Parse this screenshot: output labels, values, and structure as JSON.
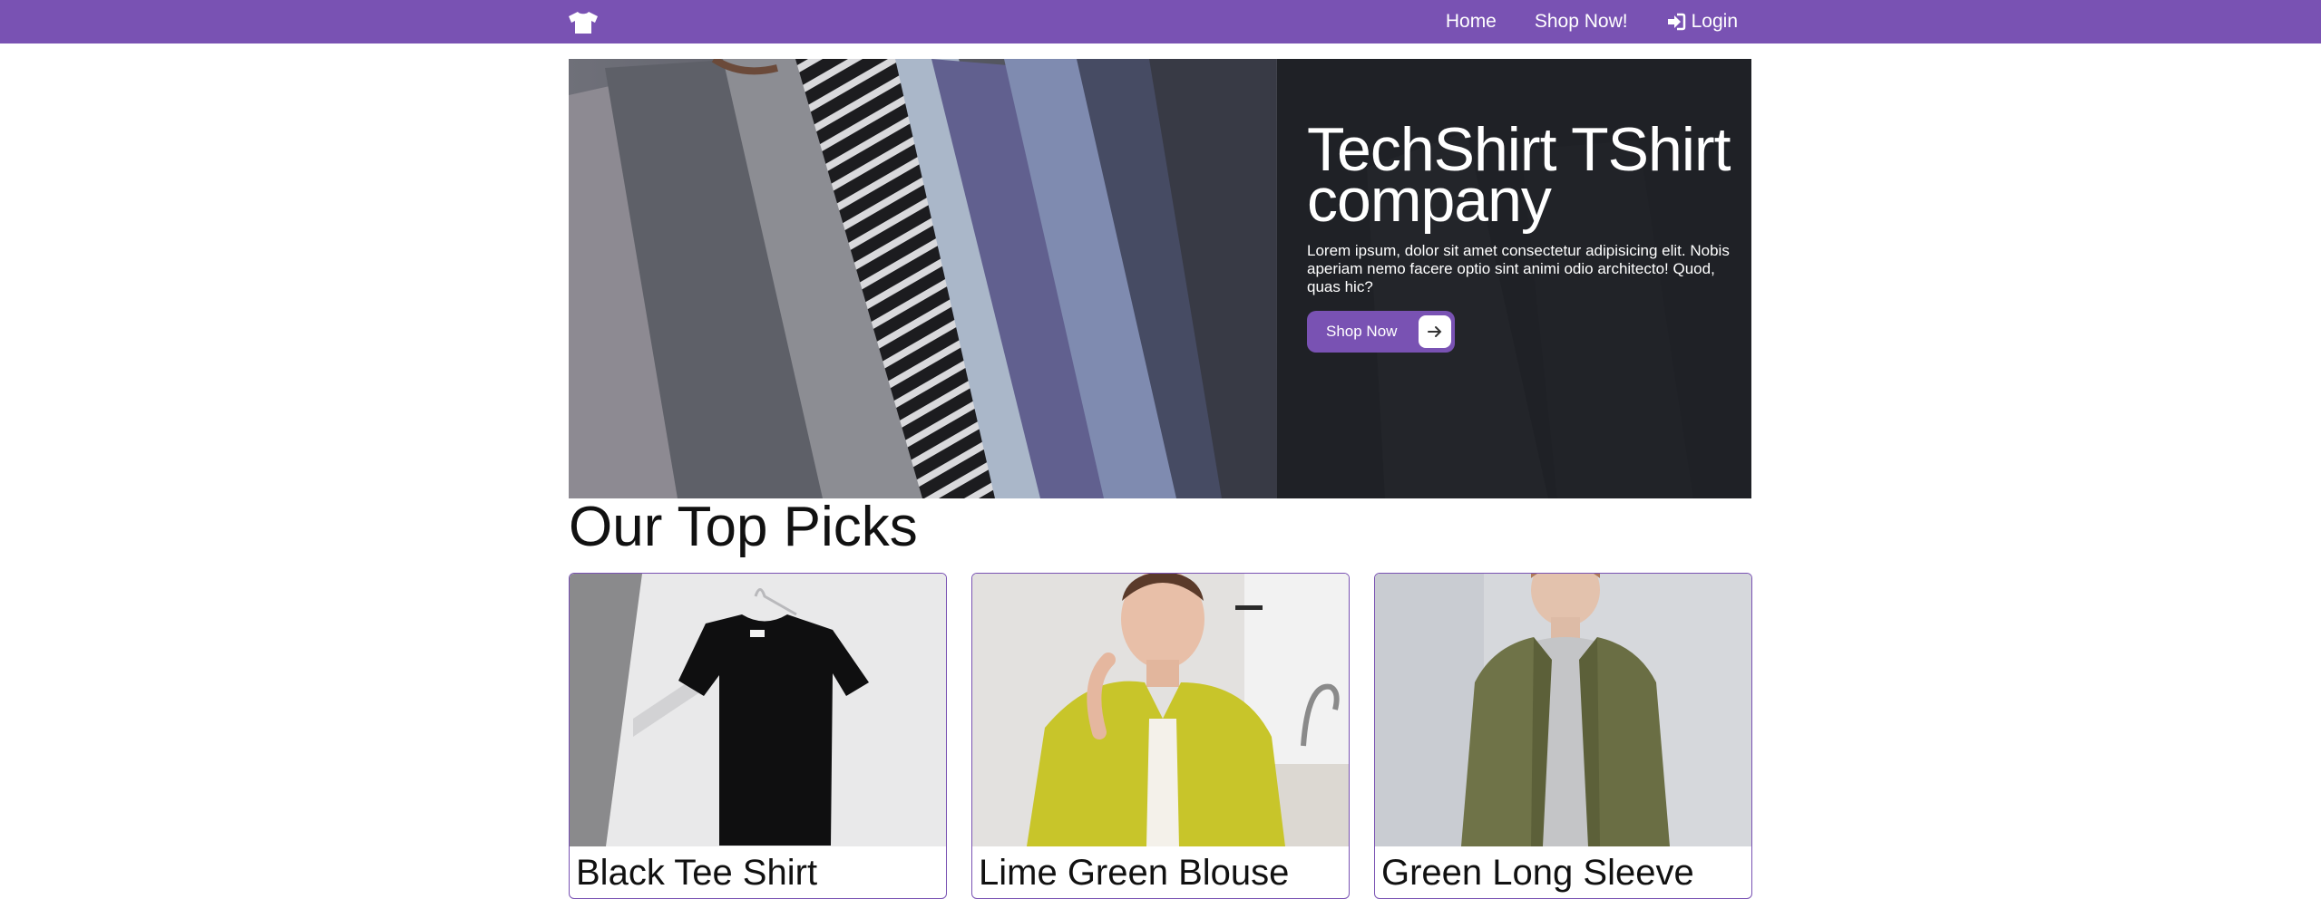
{
  "nav": {
    "brand_icon": "tshirt-icon",
    "links": [
      {
        "label": "Home"
      },
      {
        "label": "Shop Now!"
      },
      {
        "label": "Login",
        "icon": "sign-in-icon"
      }
    ]
  },
  "hero": {
    "title": "TechShirt TShirt company",
    "text": "Lorem ipsum, dolor sit amet consectetur adipisicing elit. Nobis aperiam nemo facere optio sint animi odio architecto! Quod, quas hic?",
    "button_label": "Shop Now",
    "button_icon": "arrow-right-icon"
  },
  "top_picks": {
    "title": "Our Top Picks",
    "products": [
      {
        "name": "Black Tee Shirt"
      },
      {
        "name": "Lime Green Blouse"
      },
      {
        "name": "Green Long Sleeve"
      }
    ]
  },
  "colors": {
    "accent": "#7952b3",
    "white": "#ffffff"
  }
}
